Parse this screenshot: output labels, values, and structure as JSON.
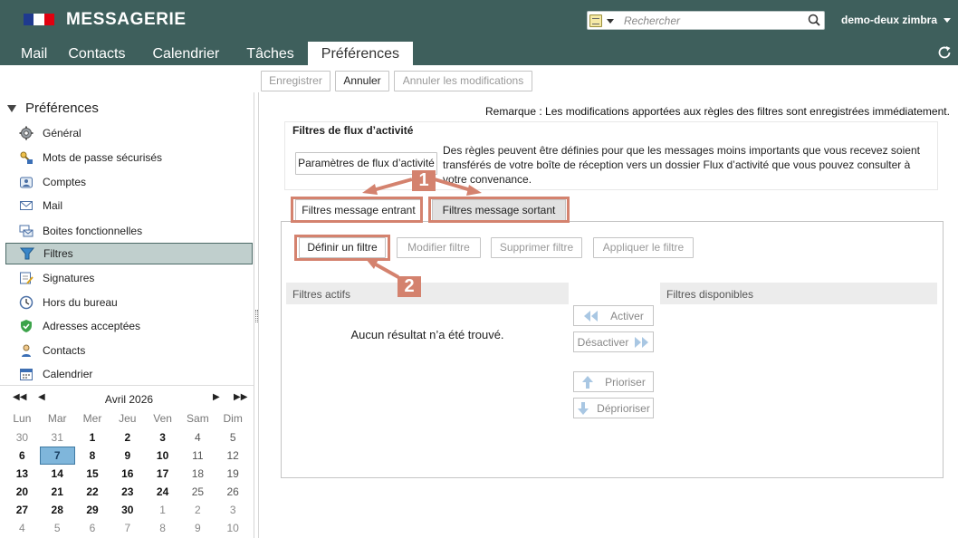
{
  "header": {
    "app_title": "MESSAGERIE",
    "flag_colors": [
      "#1f3a8f",
      "#ffffff",
      "#e1000f"
    ],
    "search": {
      "placeholder": "Rechercher",
      "type_icon": "mail-search-icon"
    },
    "user": "demo-deux zimbra"
  },
  "tabs": [
    "Mail",
    "Contacts",
    "Calendrier",
    "Tâches",
    "Préférences"
  ],
  "active_tab": "Préférences",
  "toolbar": {
    "save": "Enregistrer",
    "cancel": "Annuler",
    "revert": "Annuler les modifications"
  },
  "sidebar": {
    "title": "Préférences",
    "items": [
      {
        "label": "Général",
        "icon": "gear-icon"
      },
      {
        "label": "Mots de passe sécurisés",
        "icon": "key-icon"
      },
      {
        "label": "Comptes",
        "icon": "account-icon"
      },
      {
        "label": "Mail",
        "icon": "envelope-icon"
      },
      {
        "label": "Boites fonctionnelles",
        "icon": "shared-mailbox-icon"
      },
      {
        "label": "Filtres",
        "icon": "filter-icon",
        "selected": true
      },
      {
        "label": "Signatures",
        "icon": "signature-icon"
      },
      {
        "label": "Hors du bureau",
        "icon": "clock-icon"
      },
      {
        "label": "Adresses acceptées",
        "icon": "shield-check-icon"
      },
      {
        "label": "Contacts",
        "icon": "contact-icon"
      },
      {
        "label": "Calendrier",
        "icon": "calendar-icon"
      }
    ]
  },
  "minical": {
    "title": "Avril 2026",
    "days": [
      "Lun",
      "Mar",
      "Mer",
      "Jeu",
      "Ven",
      "Sam",
      "Dim"
    ],
    "weeks": [
      [
        "30",
        "31",
        "1",
        "2",
        "3",
        "4",
        "5"
      ],
      [
        "6",
        "7",
        "8",
        "9",
        "10",
        "11",
        "12"
      ],
      [
        "13",
        "14",
        "15",
        "16",
        "17",
        "18",
        "19"
      ],
      [
        "20",
        "21",
        "22",
        "23",
        "24",
        "25",
        "26"
      ],
      [
        "27",
        "28",
        "29",
        "30",
        "1",
        "2",
        "3"
      ],
      [
        "4",
        "5",
        "6",
        "7",
        "8",
        "9",
        "10"
      ]
    ],
    "today": "7"
  },
  "main": {
    "note": "Remarque : Les modifications apportées aux règles des filtres sont enregistrées immédiatement.",
    "activity": {
      "title": "Filtres de flux d’activité",
      "button": "Paramètres de flux d’activité",
      "description": "Des règles peuvent être définies pour que les messages moins importants que vous recevez soient transférés de votre boîte de réception vers un dossier Flux d’activité que vous pouvez consulter à votre convenance."
    },
    "filter_tabs": [
      "Filtres message entrant",
      "Filtres message sortant"
    ],
    "actions": [
      "Définir un filtre",
      "Modifier filtre",
      "Supprimer filtre",
      "Appliquer le filtre"
    ],
    "active_filters_header": "Filtres actifs",
    "available_filters_header": "Filtres disponibles",
    "empty_message": "Aucun résultat n’a été trouvé.",
    "move_buttons": [
      "Activer",
      "Désactiver",
      "Prioriser",
      "Déprioriser"
    ]
  },
  "annotations": {
    "callout_1": "1",
    "callout_2": "2",
    "color": "#d4826e"
  }
}
